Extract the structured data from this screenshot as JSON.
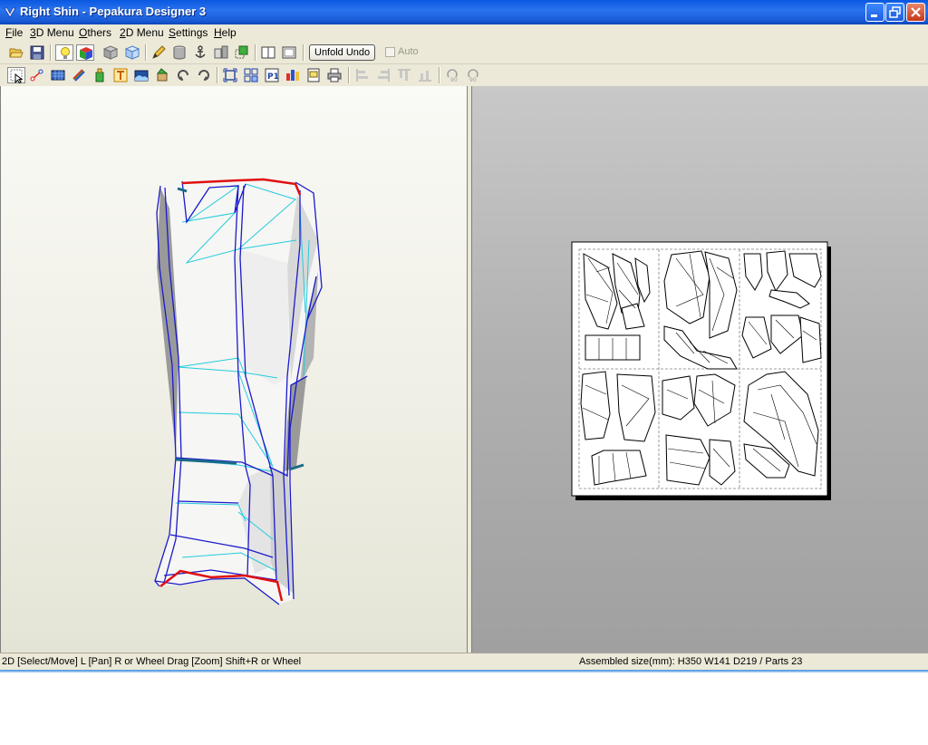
{
  "window": {
    "title": "Right Shin - Pepakura Designer 3"
  },
  "menu": {
    "items": [
      {
        "label": "File",
        "key": "F",
        "rest": "ile"
      },
      {
        "label": "3D Menu",
        "key": "3",
        "rest": "D Menu"
      },
      {
        "label": "Others",
        "key": "O",
        "rest": "thers"
      },
      {
        "label": "2D Menu",
        "key": "2",
        "rest": "D Menu"
      },
      {
        "label": "Settings",
        "key": "S",
        "rest": "ettings"
      },
      {
        "label": "Help",
        "key": "H",
        "rest": "elp"
      }
    ]
  },
  "toolbar": {
    "unfold_undo_label": "Unfold Undo",
    "auto_label": "Auto",
    "auto_checked": false
  },
  "status": {
    "left": "2D [Select/Move] L [Pan] R or Wheel Drag [Zoom] Shift+R or Wheel",
    "right": "Assembled size(mm): H350 W141 D219 / Parts 23"
  },
  "colors": {
    "titlebar": "#1a5bd6",
    "chrome": "#ece9d8",
    "edge_blue": "#1a1acc",
    "fold_cyan": "#22ccdd",
    "cut_red": "#e01010"
  }
}
